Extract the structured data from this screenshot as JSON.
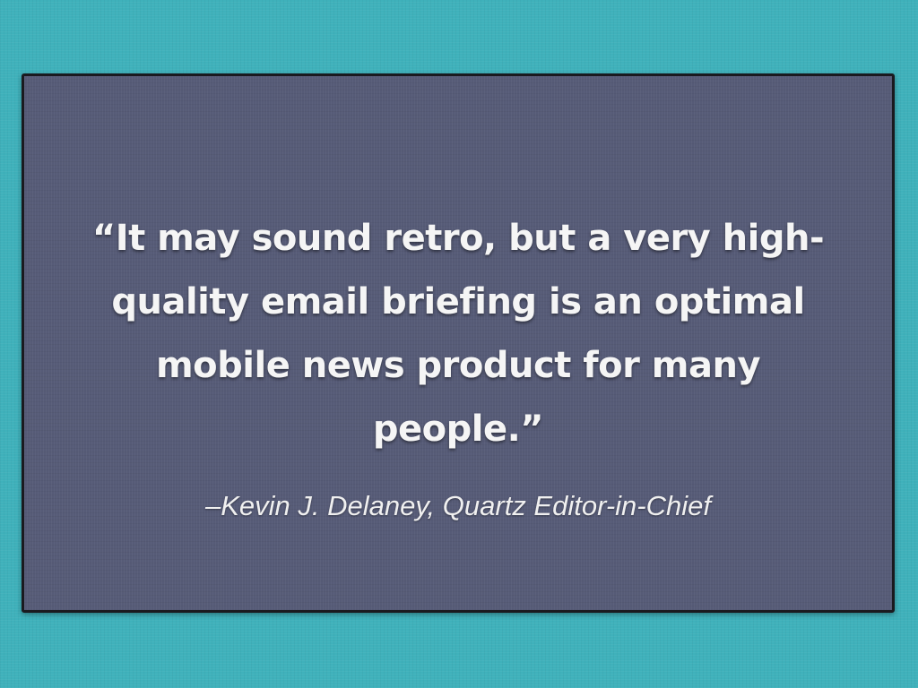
{
  "slide": {
    "quote": "“It may sound retro, but a very high-quality email briefing is an optimal mobile news product for many people.”",
    "attribution": "–Kevin J. Delaney, Quartz Editor-in-Chief"
  },
  "colors": {
    "background": "#3fb1bb",
    "panel": "#565b77",
    "panel_border": "#1a1a1f",
    "text": "#f5f5f5"
  }
}
